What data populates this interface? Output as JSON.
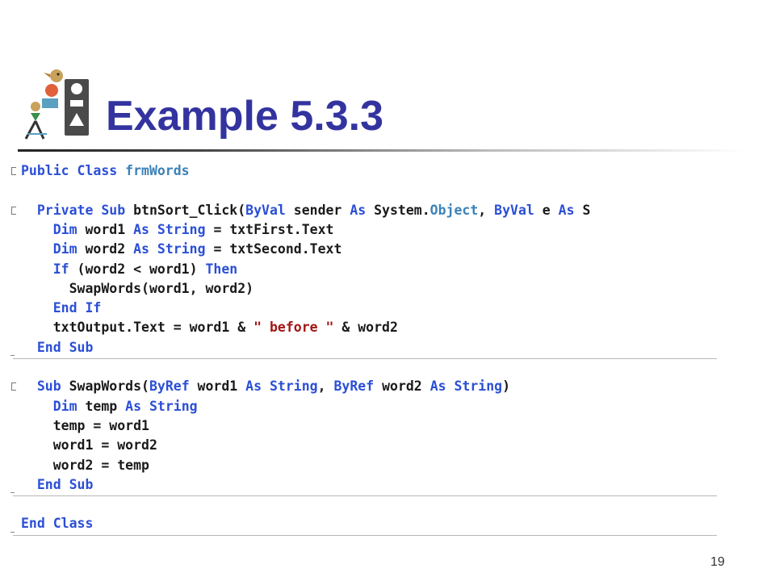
{
  "slide": {
    "title": "Example 5.3.3",
    "page_number": "19"
  },
  "code": {
    "lines": [
      [
        [
          "Public Class ",
          "kw"
        ],
        [
          "frmWords",
          "type"
        ]
      ],
      [],
      [
        [
          "  Private Sub ",
          "kw"
        ],
        [
          "btnSort_Click(",
          "plain"
        ],
        [
          "ByVal",
          "kw"
        ],
        [
          " sender ",
          "plain"
        ],
        [
          "As",
          "kw"
        ],
        [
          " System.",
          "plain"
        ],
        [
          "Object",
          "type"
        ],
        [
          ", ",
          "plain"
        ],
        [
          "ByVal",
          "kw"
        ],
        [
          " e ",
          "plain"
        ],
        [
          "As",
          "kw"
        ],
        [
          " S",
          "plain"
        ]
      ],
      [
        [
          "    Dim",
          "kw"
        ],
        [
          " word1 ",
          "plain"
        ],
        [
          "As",
          "kw"
        ],
        [
          " ",
          "plain"
        ],
        [
          "String",
          "kw"
        ],
        [
          " = txtFirst.Text",
          "plain"
        ]
      ],
      [
        [
          "    Dim",
          "kw"
        ],
        [
          " word2 ",
          "plain"
        ],
        [
          "As",
          "kw"
        ],
        [
          " ",
          "plain"
        ],
        [
          "String",
          "kw"
        ],
        [
          " = txtSecond.Text",
          "plain"
        ]
      ],
      [
        [
          "    If",
          "kw"
        ],
        [
          " (word2 < word1) ",
          "plain"
        ],
        [
          "Then",
          "kw"
        ]
      ],
      [
        [
          "      SwapWords(word1, word2)",
          "plain"
        ]
      ],
      [
        [
          "    End If",
          "kw"
        ]
      ],
      [
        [
          "    txtOutput.Text = word1 & ",
          "plain"
        ],
        [
          "\" before \"",
          "str"
        ],
        [
          " & word2",
          "plain"
        ]
      ],
      [
        [
          "  End Sub",
          "kw"
        ]
      ],
      [],
      [
        [
          "  Sub",
          "kw"
        ],
        [
          " SwapWords(",
          "plain"
        ],
        [
          "ByRef",
          "kw"
        ],
        [
          " word1 ",
          "plain"
        ],
        [
          "As",
          "kw"
        ],
        [
          " ",
          "plain"
        ],
        [
          "String",
          "kw"
        ],
        [
          ", ",
          "plain"
        ],
        [
          "ByRef",
          "kw"
        ],
        [
          " word2 ",
          "plain"
        ],
        [
          "As",
          "kw"
        ],
        [
          " ",
          "plain"
        ],
        [
          "String",
          "kw"
        ],
        [
          ")",
          "plain"
        ]
      ],
      [
        [
          "    Dim",
          "kw"
        ],
        [
          " temp ",
          "plain"
        ],
        [
          "As",
          "kw"
        ],
        [
          " ",
          "plain"
        ],
        [
          "String",
          "kw"
        ]
      ],
      [
        [
          "    temp = word1",
          "plain"
        ]
      ],
      [
        [
          "    word1 = word2",
          "plain"
        ]
      ],
      [
        [
          "    word2 = temp",
          "plain"
        ]
      ],
      [
        [
          "  End Sub",
          "kw"
        ]
      ],
      [],
      [
        [
          "End Class",
          "kw"
        ]
      ]
    ]
  },
  "colors": {
    "title": "#3333a0",
    "keyword": "#2b4fd6",
    "type": "#3b82b8",
    "string": "#a31515"
  }
}
